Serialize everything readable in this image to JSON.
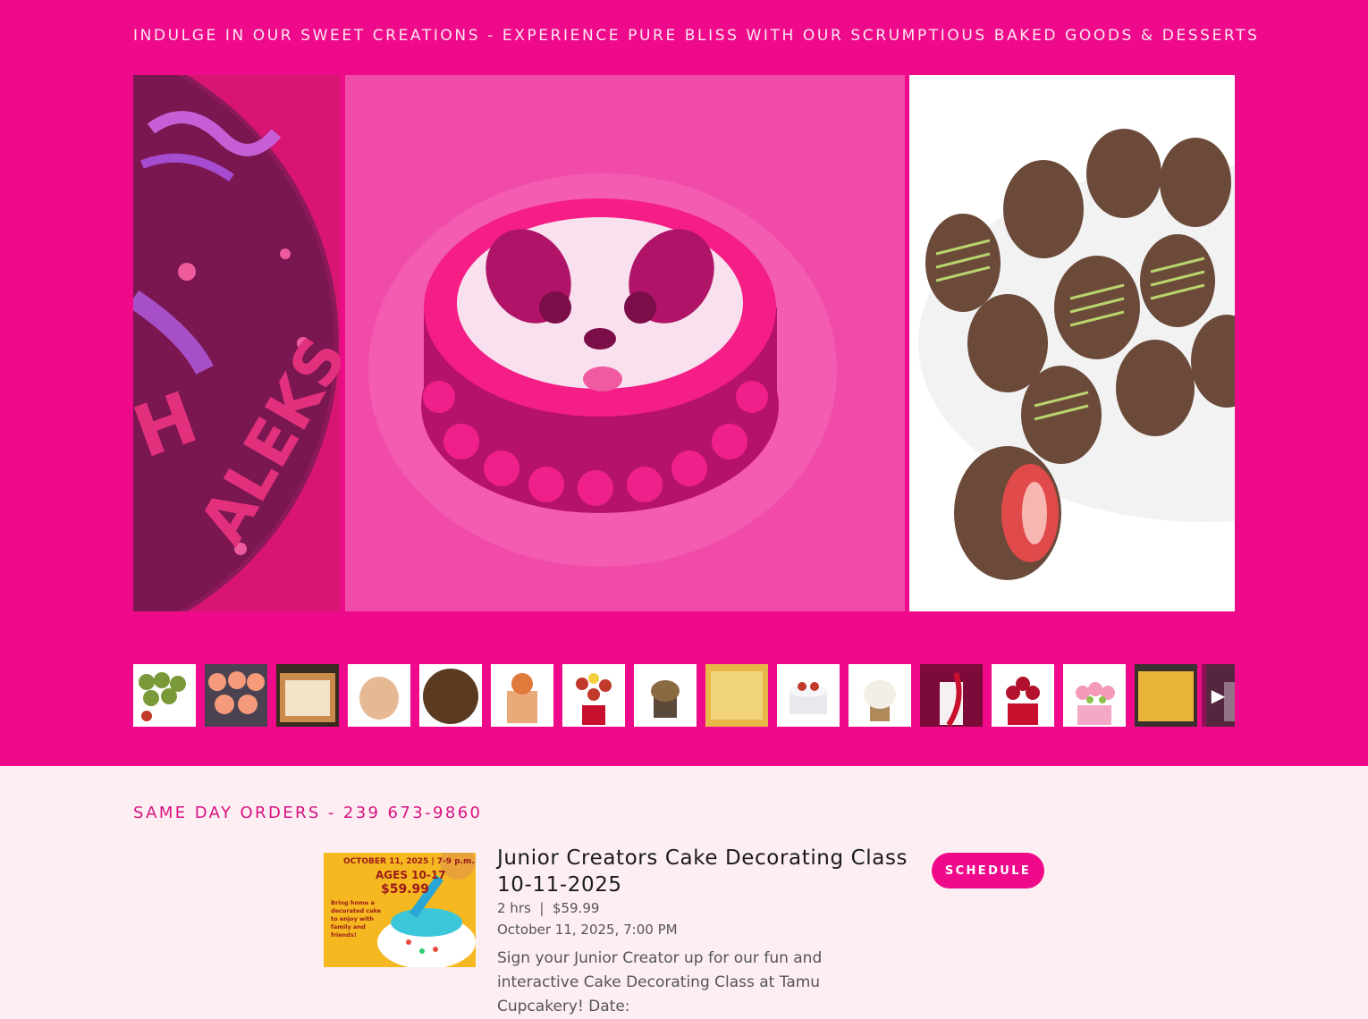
{
  "hero": {
    "tagline": "INDULGE IN OUR SWEET CREATIONS - EXPERIENCE PURE BLISS WITH OUR SCRUMPTIOUS BAKED GOODS & DESSERTS",
    "background_color": "#ee0a8a",
    "gallery": {
      "slides": [
        {
          "name": "cake-letters",
          "state": "previous"
        },
        {
          "name": "panda-cake",
          "state": "active"
        },
        {
          "name": "chocolate-strawberries",
          "state": "next"
        }
      ],
      "thumbnails_count": 16,
      "next_icon": "play-triangle-icon"
    }
  },
  "section": {
    "same_day": "SAME DAY ORDERS - 239 673-9860",
    "accent_color": "#d6127f"
  },
  "service": {
    "image": {
      "line1": "OCTOBER 11, 2025 | 7-9 p.m.",
      "line2": "AGES 10-17",
      "line3": "$59.99",
      "line4": "Bring home a decorated cake to enjoy with family and friends!"
    },
    "title": "Junior Creators Cake Decorating Class 10-11-2025",
    "meta": "2 hrs  |  $59.99",
    "date": "October 11, 2025, 7:00 PM",
    "description": "Sign your Junior Creator up for our fun and interactive Cake Decorating Class at Tamu Cupcakery! Date:",
    "button_label": "SCHEDULE"
  }
}
